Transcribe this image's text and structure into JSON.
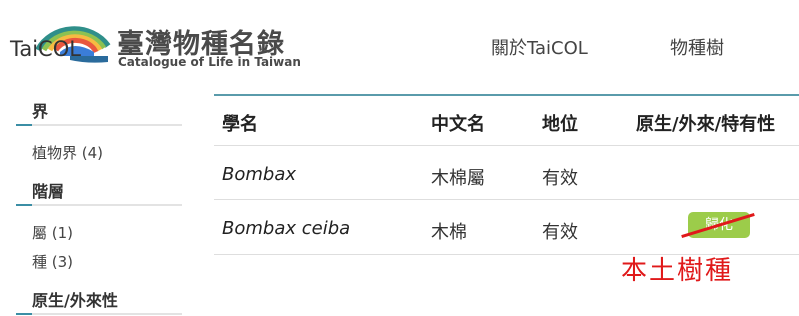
{
  "header": {
    "logo_text": "TaiCOL",
    "title": "臺灣物種名錄",
    "subtitle": "Catalogue of Life in Taiwan",
    "nav": [
      "關於TaiCOL",
      "物種樹"
    ]
  },
  "sidebar": {
    "facets": [
      {
        "title": "界",
        "items": [
          "植物界 (4)"
        ]
      },
      {
        "title": "階層",
        "items": [
          "屬 (1)",
          "種 (3)"
        ]
      },
      {
        "title": "原生/外來性",
        "items": []
      }
    ]
  },
  "table": {
    "headers": [
      "學名",
      "中文名",
      "地位",
      "原生/外來/特有性"
    ],
    "rows": [
      {
        "scientific_name": "Bombax",
        "common_name": "木棉屬",
        "status": "有效",
        "origin": ""
      },
      {
        "scientific_name": "Bombax ceiba",
        "common_name": "木棉",
        "status": "有效",
        "origin": "歸化"
      }
    ]
  },
  "annotation": {
    "text": "本土樹種",
    "color": "#e0191a"
  },
  "colors": {
    "accent": "#3b8ea5",
    "badge": "#9ccc4a"
  }
}
